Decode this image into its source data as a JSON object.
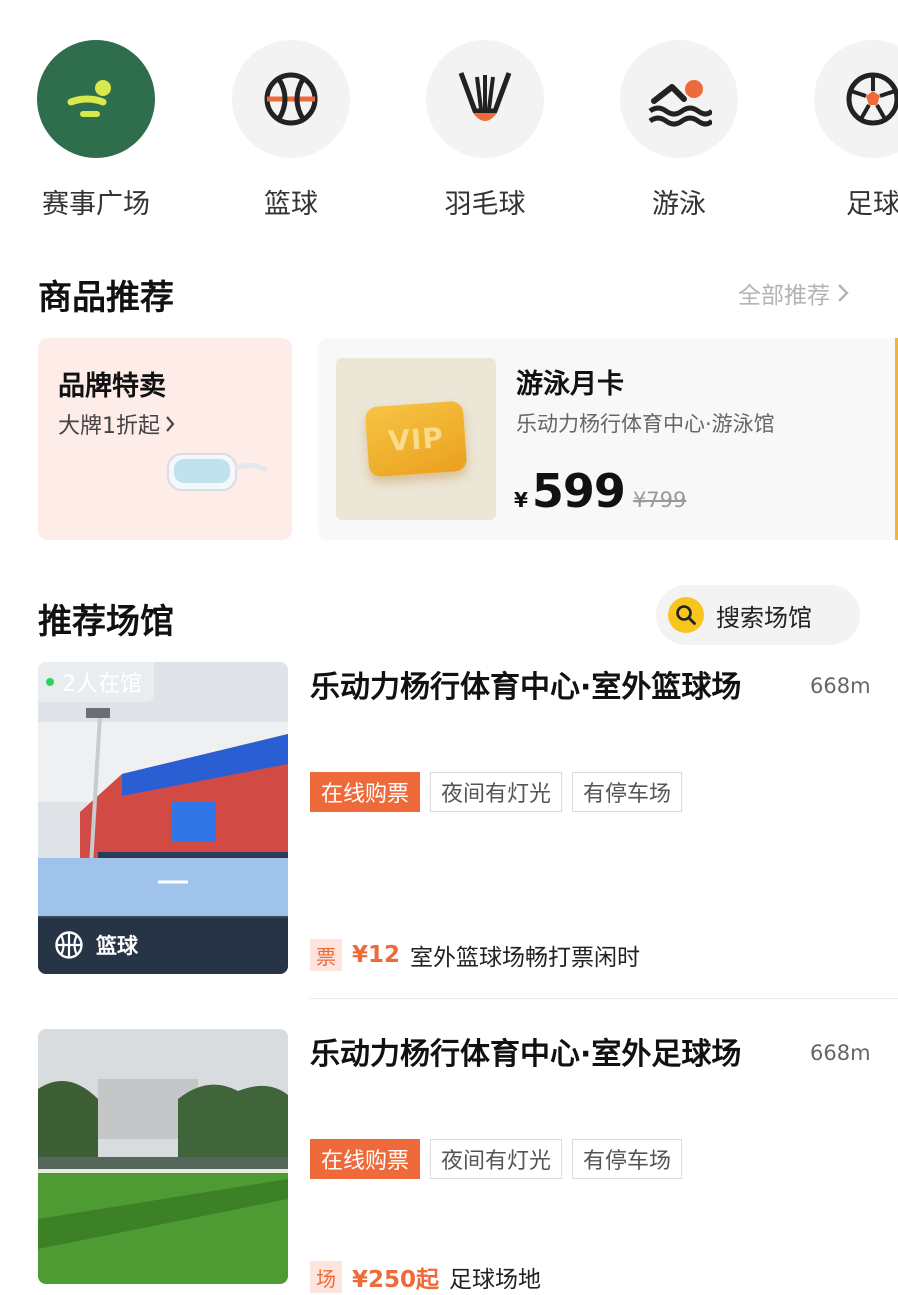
{
  "categories": [
    {
      "label": "赛事广场",
      "icon": "event-plaza-icon"
    },
    {
      "label": "篮球",
      "icon": "basketball-icon"
    },
    {
      "label": "羽毛球",
      "icon": "shuttlecock-icon"
    },
    {
      "label": "游泳",
      "icon": "swimmer-icon"
    },
    {
      "label": "足球",
      "icon": "football-icon"
    }
  ],
  "products_section": {
    "title": "商品推荐",
    "more_label": "全部推荐",
    "brand_card": {
      "title": "品牌特卖",
      "subtitle": "大牌1折起",
      "icon": "goggles-icon"
    },
    "product": {
      "title": "游泳月卡",
      "venue": "乐动力杨行体育中心·游泳馆",
      "currency": "¥",
      "price": "599",
      "original_price": "¥799",
      "thumb_text": "VIP"
    }
  },
  "venues_section": {
    "title": "推荐场馆",
    "search_label": "搜索场馆",
    "venues": [
      {
        "title": "乐动力杨行体育中心·室外篮球场",
        "distance": "668m",
        "tags": [
          "在线购票",
          "夜间有灯光",
          "有停车场"
        ],
        "occupancy": "2人在馆",
        "sport": "篮球",
        "deal_badge": "票",
        "deal_price": "¥12",
        "deal_desc": "室外篮球场畅打票闲时"
      },
      {
        "title": "乐动力杨行体育中心·室外足球场",
        "distance": "668m",
        "tags": [
          "在线购票",
          "夜间有灯光",
          "有停车场"
        ],
        "deal_badge": "场",
        "deal_price": "¥250起",
        "deal_desc": "足球场地"
      }
    ]
  },
  "colors": {
    "accent": "#ee6a3b",
    "event_green": "#2e6e4c",
    "search_yellow": "#f7c51e"
  }
}
